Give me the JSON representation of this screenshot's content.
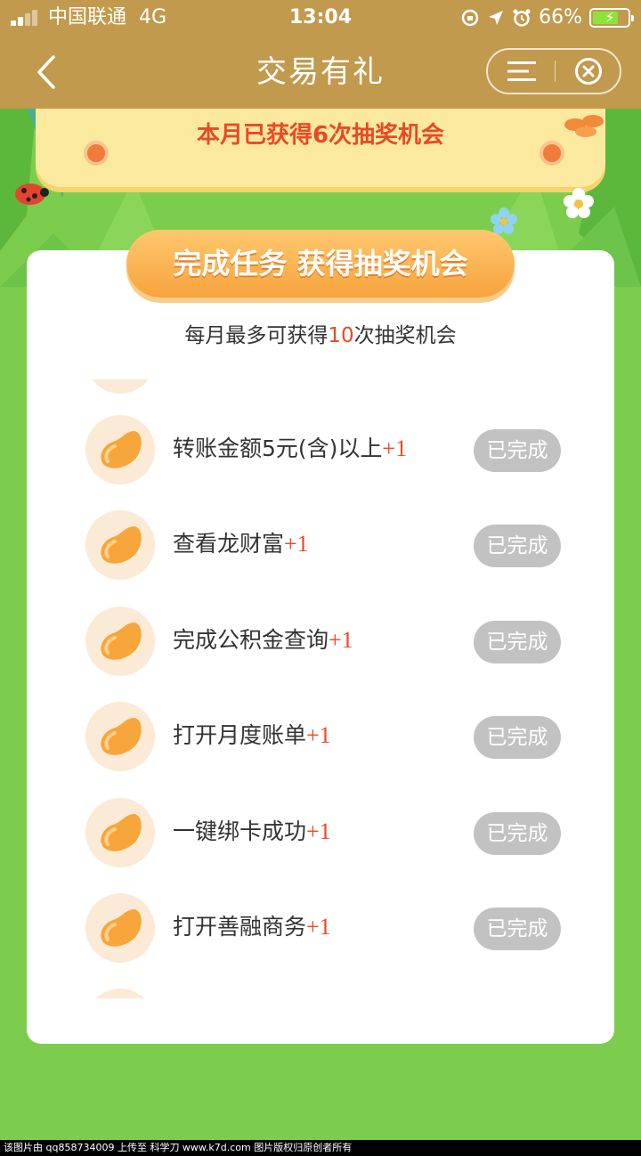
{
  "status_bar": {
    "carrier": "中国联通",
    "network": "4G",
    "time": "13:04",
    "battery": "66%",
    "icons": [
      "signal-icon",
      "screen-lock-icon",
      "location-arrow-icon",
      "alarm-icon",
      "battery-icon"
    ]
  },
  "nav": {
    "title": "交易有礼",
    "icons": [
      "back-icon",
      "menu-icon",
      "close-icon"
    ]
  },
  "banner": {
    "text": "本月已获得6次抽奖机会"
  },
  "card": {
    "ribbon": "完成任务 获得抽奖机会",
    "subtitle_prefix": "每月最多可获得",
    "subtitle_num": "10",
    "subtitle_suffix": "次抽奖机会",
    "tasks": [
      {
        "label": "转账金额5元(含)以上",
        "reward": "+1",
        "status": "已完成"
      },
      {
        "label": "查看龙财富",
        "reward": "+1",
        "status": "已完成"
      },
      {
        "label": "完成公积金查询",
        "reward": "+1",
        "status": "已完成"
      },
      {
        "label": "打开月度账单",
        "reward": "+1",
        "status": "已完成"
      },
      {
        "label": "一键绑卡成功",
        "reward": "+1",
        "status": "已完成"
      },
      {
        "label": "打开善融商务",
        "reward": "+1",
        "status": "已完成"
      }
    ]
  },
  "watermark": "该图片由 qq858734009 上传至 科学刀 www.k7d.com 图片版权归原创者所有",
  "colors": {
    "header": "#c19a4e",
    "grass": "#7ccd4e",
    "accent_red": "#e84a25",
    "ribbon_orange": "#f7a33d",
    "done_gray": "#c2c2c2"
  }
}
